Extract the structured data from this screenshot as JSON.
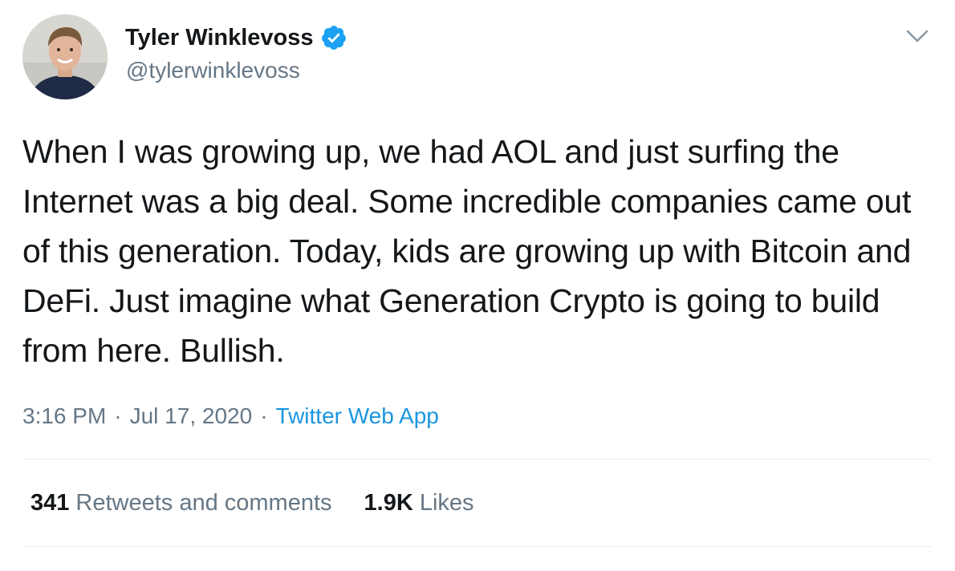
{
  "author": {
    "display_name": "Tyler Winklevoss",
    "handle": "@tylerwinklevoss",
    "verified": true
  },
  "tweet": {
    "text": "When I was growing up, we had AOL and just surfing the Internet was a big deal. Some incredible companies came out of this generation. Today, kids are growing up with Bitcoin and DeFi. Just imagine what Generation Crypto is going to build from here. Bullish."
  },
  "meta": {
    "time": "3:16 PM",
    "separator": "·",
    "date": "Jul 17, 2020",
    "source": "Twitter Web App"
  },
  "stats": {
    "retweets_count": "341",
    "retweets_label": "Retweets and comments",
    "likes_count": "1.9K",
    "likes_label": "Likes"
  },
  "icons": {
    "verified": "verified-badge-icon",
    "caret": "chevron-down-icon"
  },
  "colors": {
    "text_primary": "#14171a",
    "text_secondary": "#657786",
    "link": "#1b95e0",
    "verified": "#1da1f2",
    "divider": "#e6ecf0"
  }
}
